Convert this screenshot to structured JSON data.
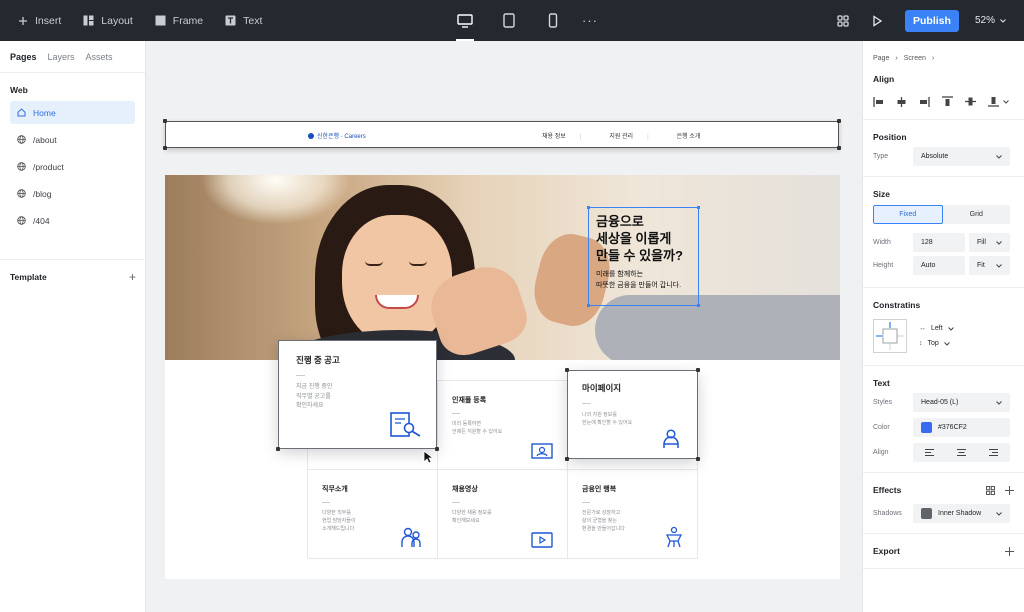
{
  "toolbar": {
    "insert": "Insert",
    "layout": "Layout",
    "frame": "Frame",
    "text": "Text",
    "more": "···",
    "publish": "Publish",
    "zoom": "52%"
  },
  "left": {
    "tabs": [
      "Pages",
      "Layers",
      "Assets"
    ],
    "section": "Web",
    "pages": [
      "Home",
      "/about",
      "/product",
      "/blog",
      "/404"
    ],
    "template": "Template",
    "template_add": "+"
  },
  "site": {
    "logo": "신한은행 · Careers",
    "nav": [
      "채용 정보",
      "지원 관리",
      "은행 소개"
    ],
    "hero_heading": "금융으로\n세상을 이롭게\n만들 수 있을까?",
    "hero_sub": "미래를 함께하는\n따뜻한 금융을 만들어 갑니다.",
    "cards": [
      {
        "title": "진행 중 공고",
        "desc": "지금 진행 중인\n직무별 공고를\n확인하세요"
      },
      {
        "title": "인재풀 등록",
        "desc": "미리 등록하면\n언제든 지원할 수 있어요"
      },
      {
        "title": "마이페이지",
        "desc": "나의 지원 정보를\n한눈에 확인할 수 있어요"
      },
      {
        "title": "직무소개",
        "desc": "다양한 직무를\n현업 담당자들이\n소개해드립니다"
      },
      {
        "title": "채용영상",
        "desc": "다양한 채용 정보를\n확인해보세요"
      },
      {
        "title": "금융인 행복",
        "desc": "전문가로 성장하고\n삶의 균형을 찾는\n환경을 만들어갑니다"
      }
    ]
  },
  "right": {
    "breadcrumb": [
      "Page",
      "Screen"
    ],
    "align": "Align",
    "position": "Position",
    "type_label": "Type",
    "type_value": "Absolute",
    "size": "Size",
    "size_fixed": "Fixed",
    "size_grid": "Grid",
    "width_label": "Width",
    "width_value": "128",
    "width_mode": "Fill",
    "height_label": "Height",
    "height_value": "Auto",
    "height_mode": "Fit",
    "constraints": "Constratins",
    "c_left": "Left",
    "c_top": "Top",
    "text": "Text",
    "styles_label": "Styles",
    "styles_value": "Head-05 (L)",
    "color_label": "Color",
    "color_value": "#376CF2",
    "align_label": "Align",
    "effects": "Effects",
    "shadows_label": "Shadows",
    "shadows_value": "Inner Shadow",
    "export": "Export"
  },
  "colors": {
    "accent": "#3b82f6",
    "brand": "#376CF2",
    "topbar": "#24292f"
  }
}
